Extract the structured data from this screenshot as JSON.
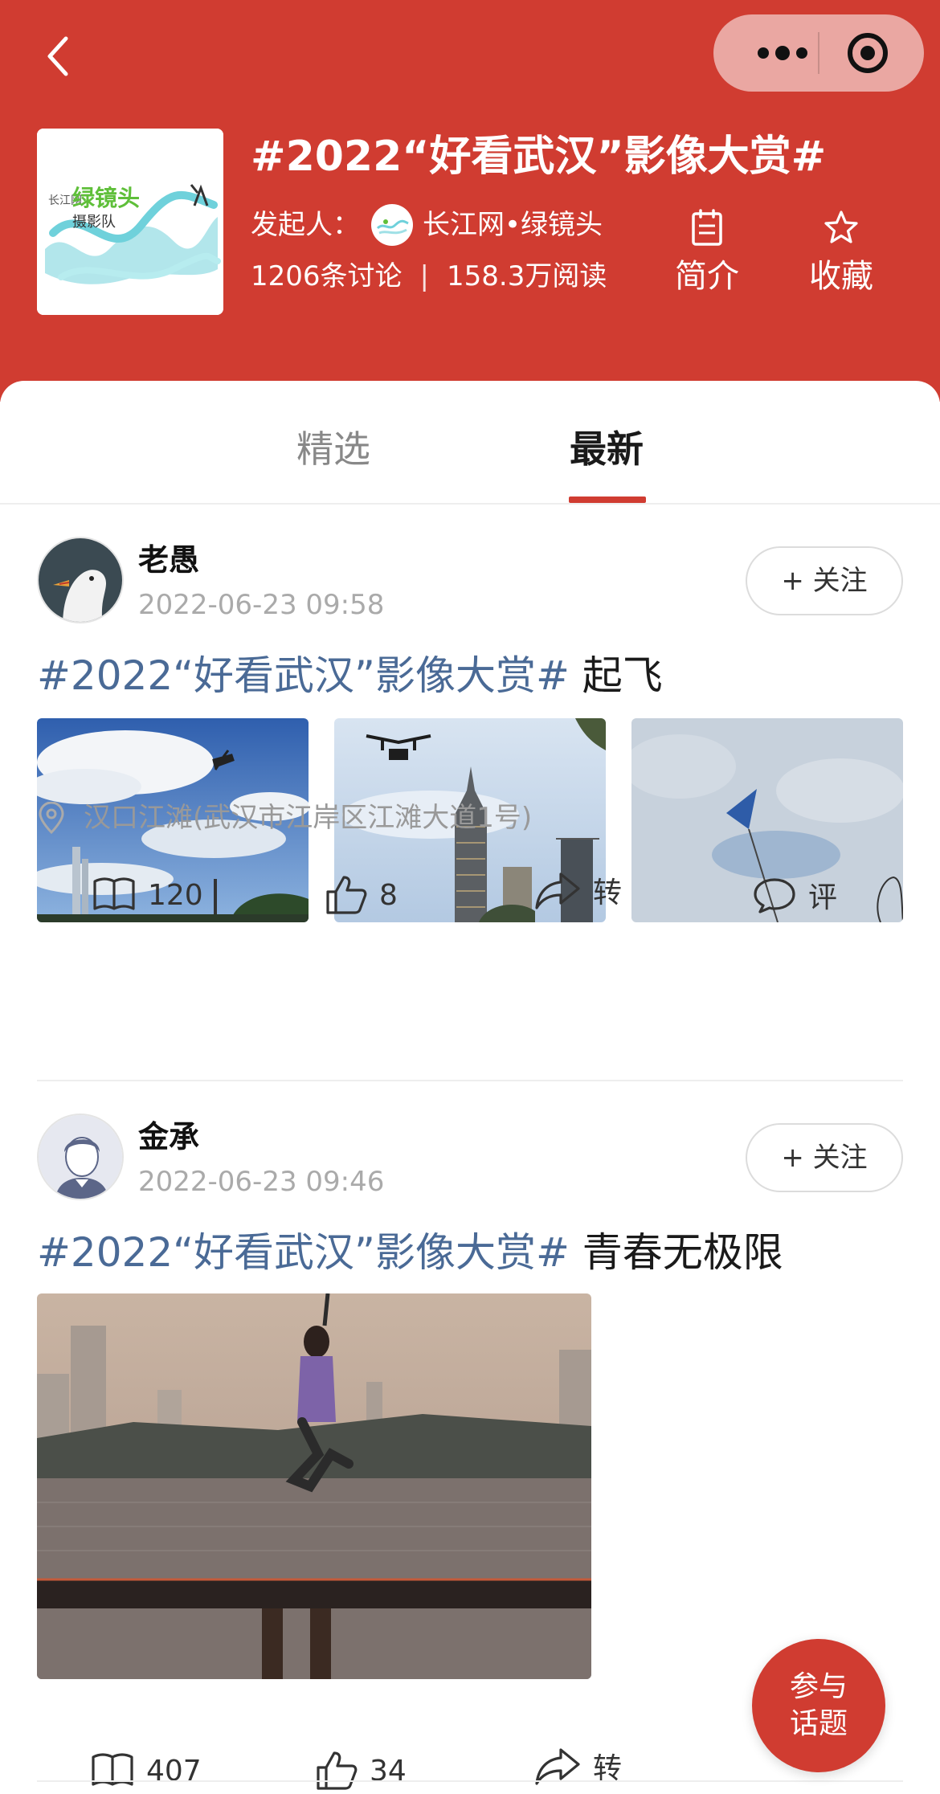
{
  "header": {
    "topic_title": "#2022“好看武汉”影像大赏#",
    "initiator_label": "发起人：",
    "initiator_name": "长江网•绿镜头",
    "cover_logo_text": "绿镜头",
    "cover_logo_subtext": "摄影队",
    "cover_logo_small": "长江网",
    "discussions": "1206条讨论",
    "stats_divider": "|",
    "reads": "158.3万阅读",
    "intro_label": "简介",
    "favorite_label": "收藏",
    "colors": {
      "brand": "#d03c31",
      "tag_text": "#4a6a96"
    }
  },
  "tabs": [
    {
      "label": "精选",
      "active": false
    },
    {
      "label": "最新",
      "active": true
    }
  ],
  "posts": [
    {
      "username": "老愚",
      "time": "2022-06-23 09:58",
      "follow_label": "+ 关注",
      "tag": "#2022“好看武汉”影像大赏#",
      "text": " 起飞",
      "location": "汉口江滩(武汉市江岸区江滩大道1号)",
      "reads": "120",
      "likes": "8",
      "share_label": "转",
      "comment_label": "评"
    },
    {
      "username": "金承",
      "time": "2022-06-23 09:46",
      "follow_label": "+ 关注",
      "tag": "#2022“好看武汉”影像大赏#",
      "text": " 青春无极限",
      "reads": "407",
      "likes": "34",
      "share_label": "转"
    }
  ],
  "fab": {
    "line1": "参与",
    "line2": "话题"
  }
}
